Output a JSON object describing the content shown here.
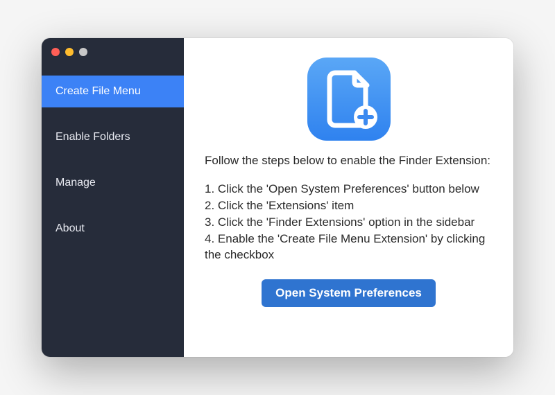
{
  "sidebar": {
    "items": [
      {
        "label": "Create File Menu",
        "active": true
      },
      {
        "label": "Enable Folders",
        "active": false
      },
      {
        "label": "Manage",
        "active": false
      },
      {
        "label": "About",
        "active": false
      }
    ]
  },
  "icon": {
    "name": "create-file-plus-icon",
    "bg_gradient_from": "#5aa7f6",
    "bg_gradient_to": "#2f82ef"
  },
  "content": {
    "intro": "Follow the steps below to enable the Finder Extension:",
    "steps": [
      "1. Click the 'Open System Preferences' button below",
      "2. Click the 'Extensions' item",
      "3. Click the 'Finder Extensions' option in the sidebar",
      "4. Enable the 'Create File Menu Extension' by clicking the checkbox"
    ],
    "button_label": "Open System Preferences"
  }
}
